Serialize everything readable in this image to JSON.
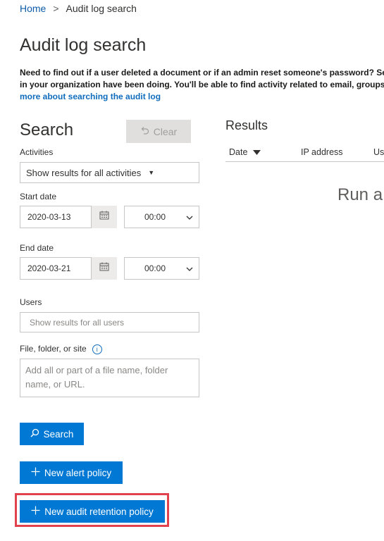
{
  "breadcrumb": {
    "home": "Home",
    "separator": ">",
    "current": "Audit log search"
  },
  "page_title": "Audit log search",
  "intro": {
    "line1": "Need to find out if a user deleted a document or if an admin reset someone's password? Search",
    "line2": "in your organization have been doing. You'll be able to find activity related to email, groups, doc",
    "link": "more about searching the audit log"
  },
  "search_panel": {
    "heading": "Search",
    "clear_label": "Clear",
    "activities_label": "Activities",
    "activities_value": "Show results for all activities",
    "start_date_label": "Start date",
    "start_date_value": "2020-03-13",
    "start_time_value": "00:00",
    "end_date_label": "End date",
    "end_date_value": "2020-03-21",
    "end_time_value": "00:00",
    "users_label": "Users",
    "users_placeholder": "Show results for all users",
    "file_label": "File, folder, or site",
    "file_placeholder": "Add all or part of a file name, folder name, or URL.",
    "search_button": "Search",
    "new_alert_button": "New alert policy",
    "new_retention_button": "New audit retention policy"
  },
  "results": {
    "heading": "Results",
    "columns": [
      "Date",
      "IP address",
      "Us"
    ],
    "run_text": "Run a"
  },
  "colors": {
    "primary": "#0078d4",
    "link": "#0f6cbd",
    "highlight": "#e0434e"
  },
  "icons": [
    "undo-icon",
    "caret-down-icon",
    "calendar-icon",
    "chevron-down-icon",
    "info-icon",
    "search-icon",
    "plus-icon",
    "sort-down-icon"
  ]
}
